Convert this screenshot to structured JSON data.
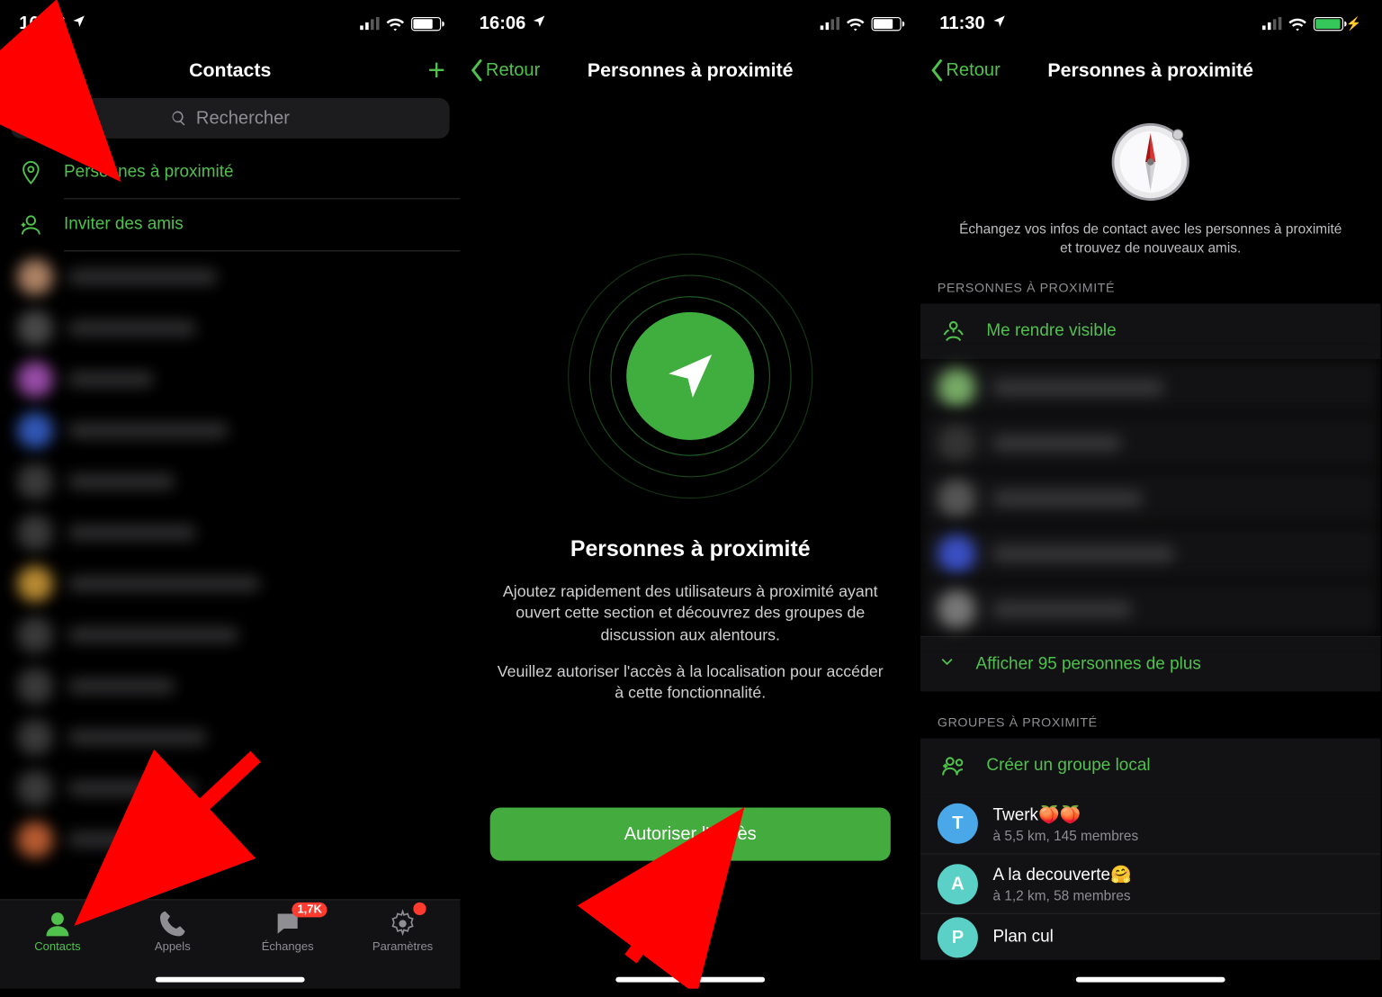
{
  "status": {
    "time1": "16:06",
    "time2": "16:06",
    "time3": "11:30"
  },
  "s1": {
    "title": "Contacts",
    "search_placeholder": "Rechercher",
    "nearby": "Personnes à proximité",
    "invite": "Inviter des amis",
    "tabs": {
      "contacts": "Contacts",
      "calls": "Appels",
      "chats": "Échanges",
      "settings": "Paramètres",
      "chats_badge": "1,7K"
    }
  },
  "s2": {
    "back": "Retour",
    "title": "Personnes à proximité",
    "heading": "Personnes à proximité",
    "p1": "Ajoutez rapidement des utilisateurs à proximité ayant ouvert cette section et découvrez des groupes de discussion aux alentours.",
    "p2": "Veuillez autoriser l'accès à la localisation pour accéder à cette fonctionnalité.",
    "btn": "Autoriser l'accès"
  },
  "s3": {
    "back": "Retour",
    "title": "Personnes à proximité",
    "intro": "Échangez vos infos de contact avec les personnes à proximité et trouvez de nouveaux amis.",
    "sec_people": "PERSONNES À PROXIMITÉ",
    "make_visible": "Me rendre visible",
    "show_more": "Afficher 95 personnes de plus",
    "sec_groups": "GROUPES À PROXIMITÉ",
    "create_group": "Créer un groupe local",
    "groups": [
      {
        "initial": "T",
        "color": "#4aa8e8",
        "name": "Twerk🍑🍑",
        "sub": "à 5,5 km, 145 membres"
      },
      {
        "initial": "A",
        "color": "#5ad0c6",
        "name": "A la decouverte🤗",
        "sub": "à 1,2 km, 58 membres"
      },
      {
        "initial": "P",
        "color": "#5ad0c6",
        "name": "Plan cul",
        "sub": ""
      }
    ]
  }
}
